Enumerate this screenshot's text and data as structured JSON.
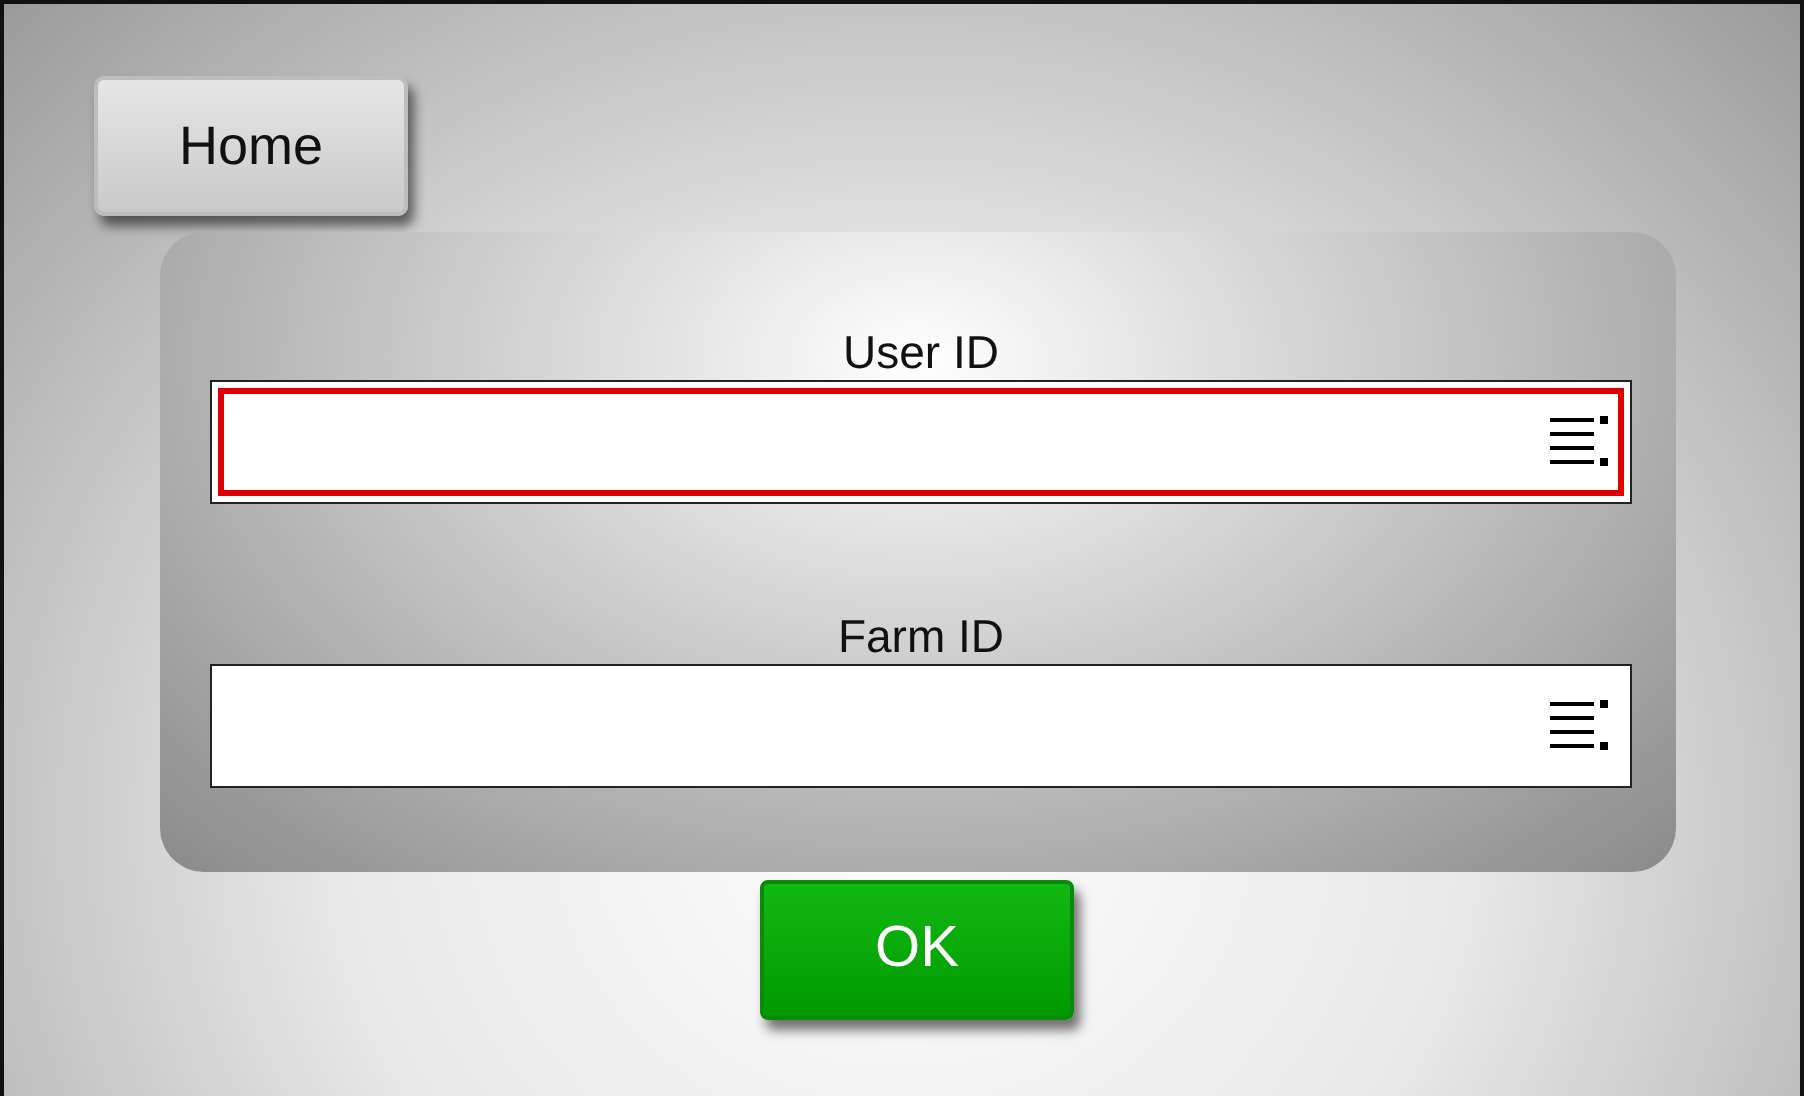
{
  "home_button": {
    "label": "Home"
  },
  "fields": [
    {
      "label": "User ID",
      "focused": true
    },
    {
      "label": "Farm ID",
      "focused": false
    }
  ],
  "ok_button": {
    "label": "OK"
  }
}
